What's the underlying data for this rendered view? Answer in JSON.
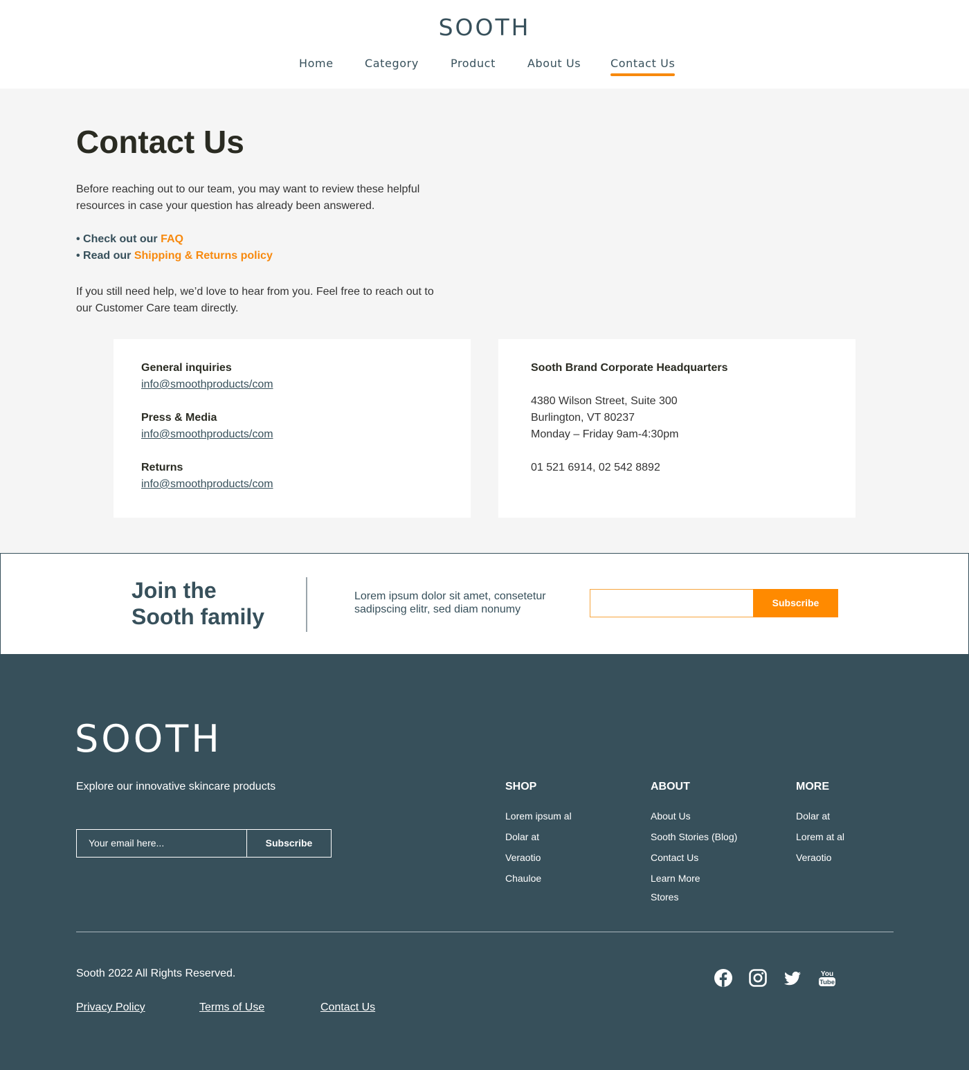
{
  "brand": "SOOTH",
  "nav": [
    {
      "label": "Home"
    },
    {
      "label": "Category"
    },
    {
      "label": "Product"
    },
    {
      "label": "About Us"
    },
    {
      "label": "Contact Us",
      "active": true
    }
  ],
  "main": {
    "title": "Contact Us",
    "intro": "Before reaching out to our team, you may want to review these helpful resources in case your question has already been answered.",
    "bullets": [
      {
        "prefix": "• Check out our ",
        "link": "FAQ"
      },
      {
        "prefix": "• Read our ",
        "link": "Shipping & Returns policy"
      }
    ],
    "outro": "If you still need help, we’d love to hear from you. Feel free to reach out to our Customer Care team directly."
  },
  "contacts": [
    {
      "label": "General inquiries",
      "email": "info@smoothproducts/com"
    },
    {
      "label": "Press & Media",
      "email": "info@smoothproducts/com"
    },
    {
      "label": "Returns",
      "email": "info@smoothproducts/com"
    }
  ],
  "hq": {
    "title": "Sooth Brand Corporate Headquarters",
    "address1": "4380 Wilson Street, Suite 300",
    "address2": "Burlington, VT 80237",
    "hours": "Monday – Friday 9am-4:30pm",
    "phones": "01 521 6914, 02 542 8892"
  },
  "newsletter": {
    "title_line1": "Join the",
    "title_line2": "Sooth family",
    "text": "Lorem ipsum dolor sit amet, consetetur sadipscing elitr, sed diam nonumy",
    "input_value": "",
    "button": "Subscribe"
  },
  "footer": {
    "logo": "SOOTH",
    "tagline": "Explore our innovative skincare products",
    "email_placeholder": "Your email here...",
    "button": "Subscribe",
    "columns": [
      {
        "heading": "SHOP",
        "links": [
          "Lorem ipsum al",
          "Dolar at",
          "Veraotio",
          "Chauloe"
        ]
      },
      {
        "heading": "ABOUT",
        "links": [
          "About Us",
          "Sooth Stories (Blog)",
          "Contact Us",
          "Learn More",
          "Stores"
        ]
      },
      {
        "heading": "MORE",
        "links": [
          "Dolar at",
          "Lorem at al",
          "Veraotio"
        ]
      }
    ],
    "copyright": "Sooth 2022 All Rights Reserved.",
    "legal": [
      "Privacy Policy",
      "Terms of Use",
      "Contact Us"
    ],
    "social": [
      "facebook-icon",
      "instagram-icon",
      "twitter-icon",
      "youtube-icon"
    ]
  },
  "colors": {
    "accent": "#f7890e",
    "primary": "#37505b",
    "background": "#f5f5f5"
  }
}
